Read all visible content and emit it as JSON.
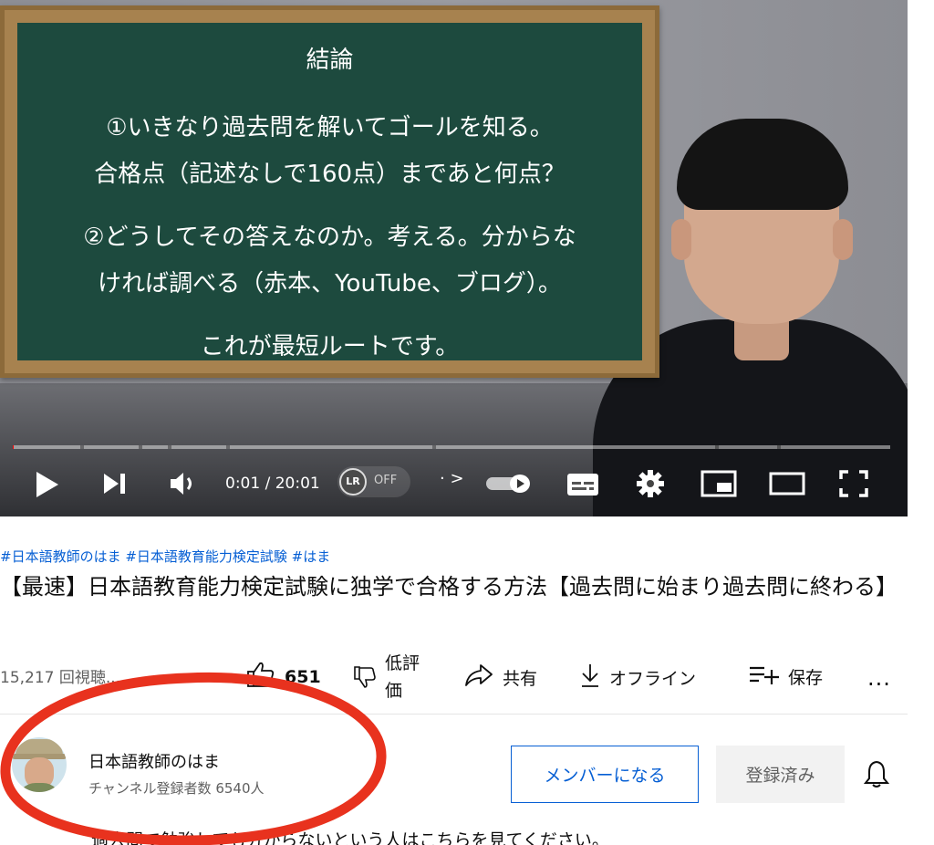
{
  "board": {
    "lines": [
      "結論",
      "①いきなり過去問を解いてゴールを知る。",
      "合格点（記述なしで160点）まであと何点？",
      "②どうしてその答えなのか。考える。分からな",
      "ければ調べる（赤本、YouTube、ブログ）。",
      "これが最短ルートです。"
    ]
  },
  "player": {
    "time": "0:01 / 20:01",
    "lr_logo": "LR",
    "lr_state": "OFF",
    "chapter_text": "· >",
    "progress_fraction": 0.001,
    "icons": {
      "play": "play-icon",
      "next": "next-icon",
      "volume": "volume-icon",
      "subtitles": "subtitles-icon",
      "settings": "gear-icon",
      "miniplayer": "miniplayer-icon",
      "theater": "theater-icon",
      "fullscreen": "fullscreen-icon"
    }
  },
  "video": {
    "hashtags": "#日本語教師のはま #日本語教育能力検定試験 #はま",
    "title": "【最速】日本語教育能力検定試験に独学で合格する方法【過去問に始まり過去問に終わる】",
    "views": "15,217 回視聴..."
  },
  "actions": {
    "like_count": "651",
    "dislike_label": "低評価",
    "share_label": "共有",
    "offline_label": "オフライン",
    "save_label": "保存",
    "more": "..."
  },
  "channel": {
    "name": "日本語教師のはま",
    "subscribers": "チャンネル登録者数 6540人",
    "member_button": "メンバーになる",
    "subscribed_button": "登録済み"
  },
  "description": "過去問で勉強しても分からないという人はこちらを見てください。",
  "colors": {
    "link": "#065fd4",
    "annotation": "#e8321e",
    "board": "#1d4a3e"
  }
}
